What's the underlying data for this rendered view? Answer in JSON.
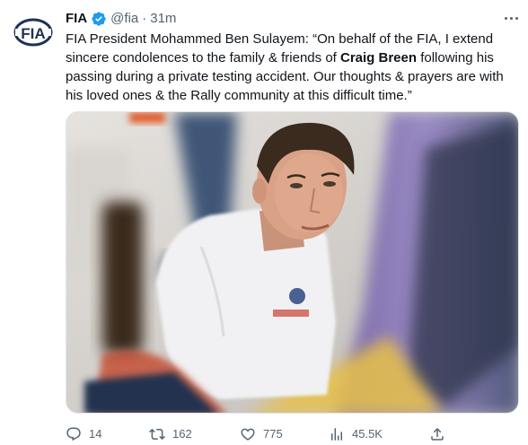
{
  "author": {
    "name": "FIA",
    "handle": "@fia",
    "separator": "·",
    "time": "31m",
    "avatar_text": "FIA"
  },
  "tweet": {
    "text_before": "FIA President Mohammed Ben Sulayem: “On behalf of the FIA, I extend sincere condolences to the family & friends of ",
    "bold_name": "Craig Breen",
    "text_after": " following his passing during a private testing accident. Our thoughts & prayers are with his loved ones & the Rally community at this difficult time.”"
  },
  "actions": {
    "replies": "14",
    "retweets": "162",
    "likes": "775",
    "views": "45.5K"
  },
  "icons": {
    "verified": "verified-badge-icon",
    "more": "more-icon",
    "reply": "reply-icon",
    "retweet": "retweet-icon",
    "like": "heart-icon",
    "views": "views-icon",
    "share": "share-icon"
  },
  "colors": {
    "text": "#0f1419",
    "secondary": "#536471",
    "verified": "#1d9bf0",
    "avatar": "#1f3157"
  }
}
